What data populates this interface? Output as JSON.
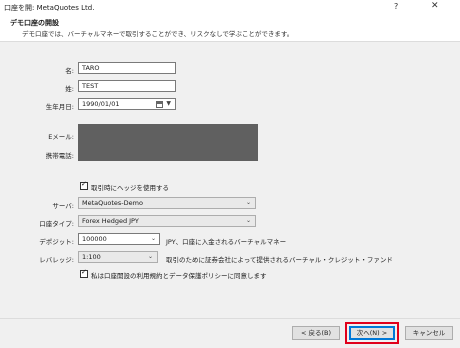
{
  "window": {
    "title": "口座を開: MetaQuotes Ltd.",
    "help_label": "?",
    "close_label": "✕"
  },
  "header": {
    "title": "デモ口座の開設",
    "subtitle": "デモ口座では、バーチャルマネーで取引することができ、リスクなしで学ぶことができます。"
  },
  "form": {
    "first_name_label": "名:",
    "first_name_value": "TARO",
    "last_name_label": "姓:",
    "last_name_value": "TEST",
    "birthday_label": "生年月日:",
    "birthday_value": "1990/01/01",
    "email_label": "Eメール:",
    "phone_label": "携帯電話:",
    "hedge_label": "取引時にヘッジを使用する",
    "hedge_checked": true,
    "server_label": "サーバ:",
    "server_value": "MetaQuotes-Demo",
    "account_type_label": "口座タイプ:",
    "account_type_value": "Forex Hedged JPY",
    "deposit_label": "デポジット:",
    "deposit_value": "100000",
    "deposit_note": "JPY、口座に入金されるバーチャルマネー",
    "leverage_label": "レバレッジ:",
    "leverage_value": "1:100",
    "leverage_note": "取引のために証券会社によって提供されるバーチャル・クレジット・ファンド",
    "agree_label": "私は口座開設の利用規約とデータ保護ポリシーに同意します",
    "agree_checked": true
  },
  "footer": {
    "back_label": "< 戻る(B)",
    "next_label": "次へ(N) >",
    "cancel_label": "キャンセル"
  },
  "colors": {
    "highlight": "#e0001b",
    "accent": "#0078d7"
  }
}
